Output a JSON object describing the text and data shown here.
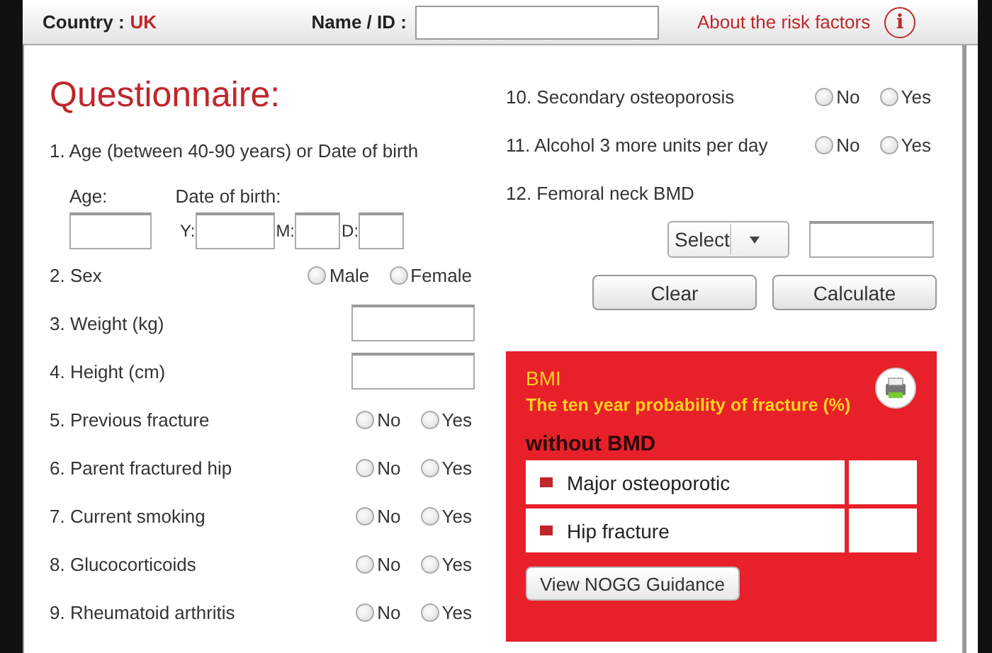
{
  "header": {
    "country_label": "Country :",
    "country": "UK",
    "name_label": "Name / ID :",
    "about_link": "About the risk factors",
    "info_icon": "i"
  },
  "title": "Questionnaire:",
  "age_question": {
    "label": "1. Age (between 40-90 years) or Date of birth",
    "age_label": "Age:",
    "dob_label": "Date of birth:",
    "dob_parts": [
      "Y:",
      "M:",
      "D:"
    ]
  },
  "left_questions": [
    {
      "kind": "radio",
      "label": "2. Sex",
      "options": [
        {
          "label": "Male",
          "selected": false
        },
        {
          "label": "Female",
          "selected": false
        }
      ]
    },
    {
      "kind": "input",
      "label": "3. Weight (kg)"
    },
    {
      "kind": "input",
      "label": "4. Height (cm)"
    },
    {
      "kind": "radio",
      "label": "5. Previous fracture",
      "options": [
        {
          "label": "No",
          "selected": false
        },
        {
          "label": "Yes",
          "selected": false
        }
      ]
    },
    {
      "kind": "radio",
      "label": "6. Parent fractured hip",
      "options": [
        {
          "label": "No",
          "selected": false
        },
        {
          "label": "Yes",
          "selected": false
        }
      ]
    },
    {
      "kind": "radio",
      "label": "7. Current smoking",
      "options": [
        {
          "label": "No",
          "selected": false
        },
        {
          "label": "Yes",
          "selected": false
        }
      ]
    },
    {
      "kind": "radio",
      "label": "8. Glucocorticoids",
      "options": [
        {
          "label": "No",
          "selected": false
        },
        {
          "label": "Yes",
          "selected": false
        }
      ]
    },
    {
      "kind": "radio",
      "label": "9. Rheumatoid arthritis",
      "options": [
        {
          "label": "No",
          "selected": false
        },
        {
          "label": "Yes",
          "selected": false
        }
      ]
    }
  ],
  "right_questions": [
    {
      "kind": "radio",
      "label": "10. Secondary osteoporosis",
      "options": [
        {
          "label": "No",
          "selected": false
        },
        {
          "label": "Yes",
          "selected": false
        }
      ]
    },
    {
      "kind": "radio",
      "label": "11. Alcohol 3 more units per day",
      "options": [
        {
          "label": "No",
          "selected": false
        },
        {
          "label": "Yes",
          "selected": false
        }
      ]
    },
    {
      "kind": "text",
      "label": "12. Femoral neck BMD"
    }
  ],
  "bmd_select": {
    "value": "Select"
  },
  "buttons": [
    "Clear",
    "Calculate"
  ],
  "results": {
    "bmi_label": "BMI",
    "subtitle": "The ten year probability of fracture (%)",
    "section": "without BMD",
    "rows": [
      {
        "label": "Major osteoporotic"
      },
      {
        "label": "Hip fracture"
      }
    ],
    "guidance_button": "View NOGG Guidance"
  }
}
